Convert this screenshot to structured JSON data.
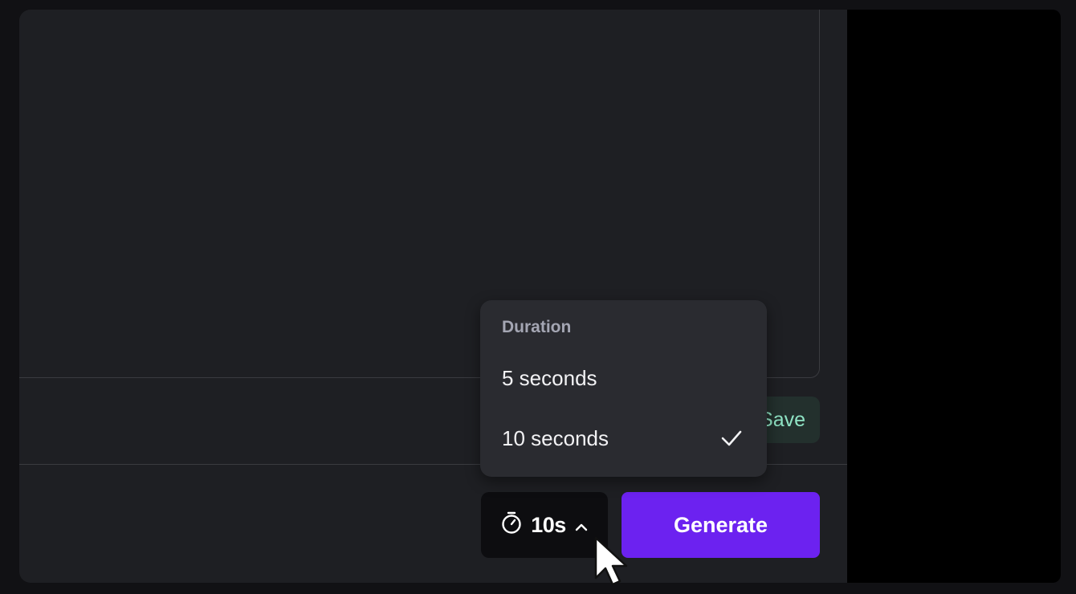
{
  "editor": {
    "prompt_placeholder": ""
  },
  "toolbar": {
    "save_label": "Save",
    "duration_value": "10s",
    "generate_label": "Generate"
  },
  "duration_menu": {
    "header": "Duration",
    "options": [
      {
        "label": "5 seconds",
        "selected": false
      },
      {
        "label": "10 seconds",
        "selected": true
      }
    ]
  },
  "colors": {
    "accent": "#6c22f0",
    "save_text": "#8fe3c4",
    "panel_bg": "#1e1f23",
    "menu_bg": "#2a2b30"
  },
  "icons": {
    "timer": "stopwatch-icon",
    "chevron": "chevron-up-icon",
    "check": "checkmark-icon",
    "cursor": "mouse-pointer-icon"
  }
}
